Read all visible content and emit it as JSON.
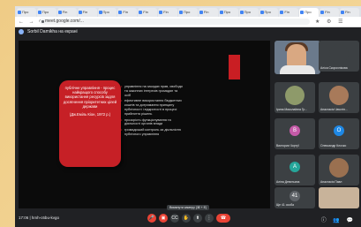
{
  "browser": {
    "tabs": [
      "Про",
      "Про",
      "Fin",
      "Fin",
      "Про",
      "Fin",
      "Fin",
      "Fin",
      "Про",
      "Fin",
      "Про",
      "Про",
      "Про",
      "Fin",
      "Про",
      "Fin",
      "Fin"
    ],
    "url": "meet.google.com/..."
  },
  "meeting": {
    "title": "Sorbil Damikha на екрані",
    "slide": {
      "card_text": "публічне управління - процес найкращого способу використання ресурсів задля досягнення пріоритетних цілей держави",
      "card_cite": "(Дж.Еміль Кіон, 1972 р.)",
      "bullets": [
        "управління на засадах прав, свободи та законних інтересів громадян та осіб",
        "ефективне використання бюджетних коштів та дотримання принципу публічності і відкритості в процесі прийняття рішень",
        "прозорість функціонування та діяльності органів влади",
        "громадський контроль за діяльністю публічного управління"
      ]
    },
    "participants": [
      {
        "name": "",
        "color": "#6b7a8c",
        "type": "video"
      },
      {
        "name": "Аліса Скорохлікова",
        "color": "#3c4043",
        "type": "photo"
      },
      {
        "name": "Ірина Миколаївна Гр...",
        "color": "#8e9a6a",
        "type": "photo"
      },
      {
        "name": "Анастасія Чекстін...",
        "color": "#a87a5a",
        "type": "photo"
      },
      {
        "name": "Виктория Чортуї",
        "initial": "B",
        "color": "#c55aa8",
        "type": "initial"
      },
      {
        "name": "Олександр Клочко",
        "initial": "O",
        "color": "#1e88e5",
        "type": "initial"
      },
      {
        "name": "Аліна Девятьяна",
        "initial": "A",
        "color": "#26a69a",
        "type": "initial"
      },
      {
        "name": "Анастасія Павл",
        "color": "#9a7050",
        "type": "photo"
      },
      {
        "name": "Ще 41 особа",
        "color": "#3c4043",
        "type": "more"
      },
      {
        "name": "",
        "color": "#c8b39a",
        "type": "video"
      }
    ],
    "time": "17:06 | hmh-c6bu-kvgo",
    "tooltip": "Вимкнути камеру (⌘ + E)"
  }
}
